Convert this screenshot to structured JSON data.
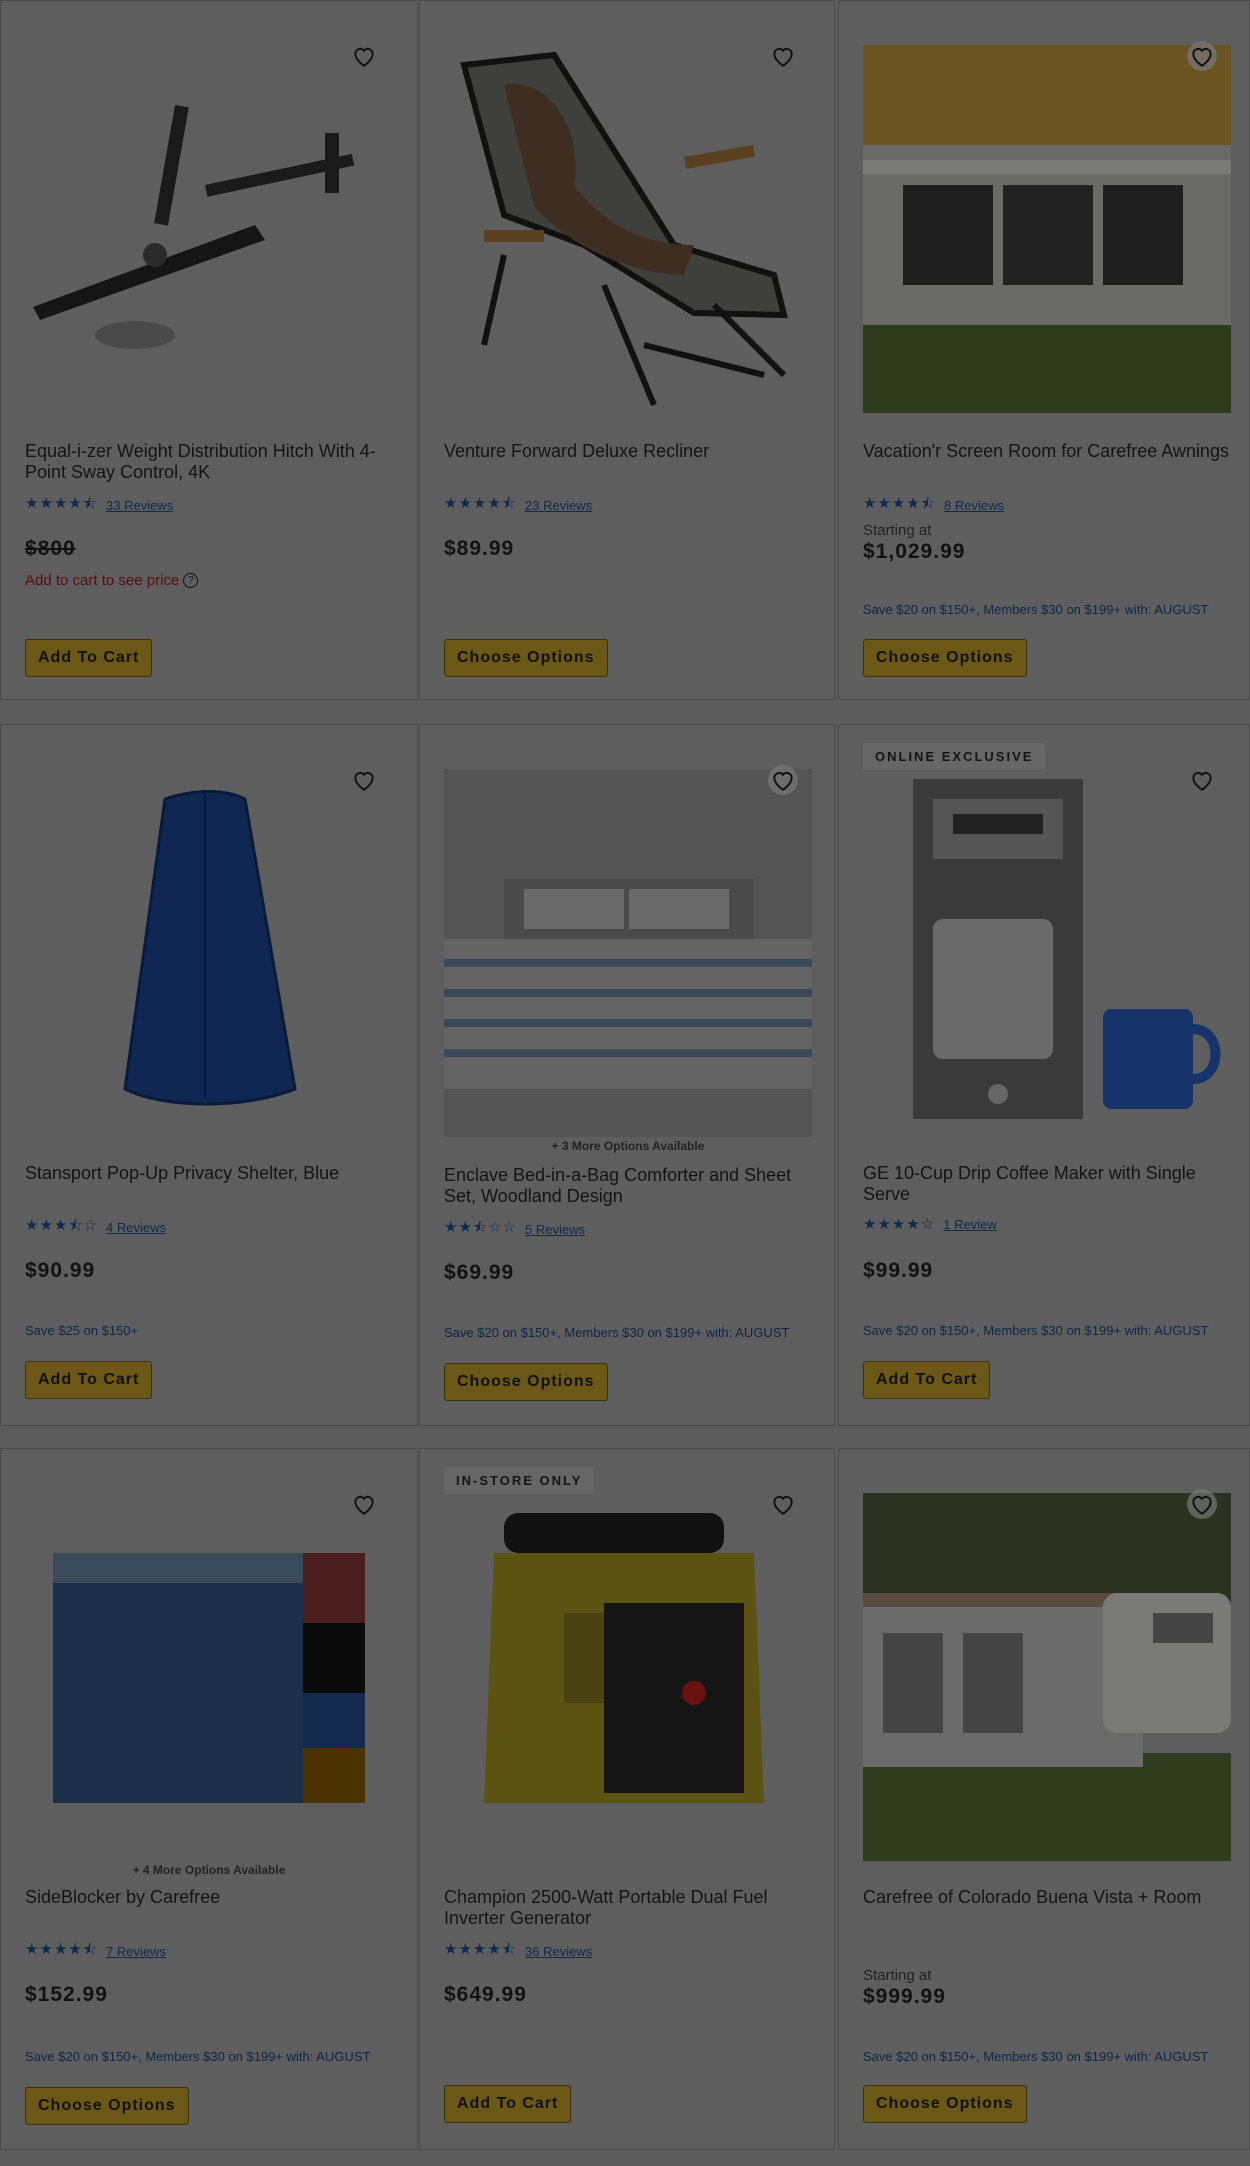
{
  "products": [
    {
      "title": "Equal-i-zer Weight Distribution Hitch With 4-Point Sway Control, 4K",
      "stars": "★★★★⯪",
      "reviews": "33 Reviews",
      "price": "$800",
      "cart_note": "Add to cart to see price",
      "button": "Add To Cart"
    },
    {
      "title": "Venture Forward Deluxe Recliner",
      "stars": "★★★★⯪",
      "reviews": "23 Reviews",
      "price": "$89.99",
      "button": "Choose Options"
    },
    {
      "title": "Vacation'r Screen Room for Carefree Awnings",
      "stars": "★★★★⯪",
      "reviews": "8 Reviews",
      "starting": "Starting at",
      "price": "$1,029.99",
      "promo": "Save $20 on $150+, Members $30 on $199+ with: AUGUST",
      "button": "Choose Options"
    },
    {
      "title": "Stansport Pop-Up Privacy Shelter, Blue",
      "stars": "★★★⯪☆",
      "reviews": "4 Reviews",
      "price": "$90.99",
      "promo": "Save $25 on $150+",
      "button": "Add To Cart"
    },
    {
      "options": "+ 3 More Options Available",
      "title": "Enclave Bed-in-a-Bag Comforter and Sheet Set, Woodland Design",
      "stars": "★★⯪☆☆",
      "reviews": "5 Reviews",
      "price": "$69.99",
      "promo": "Save $20 on $150+, Members $30 on $199+ with: AUGUST",
      "button": "Choose Options"
    },
    {
      "badge": "ONLINE EXCLUSIVE",
      "title": "GE 10-Cup Drip Coffee Maker with Single Serve",
      "stars": "★★★★☆",
      "reviews": "1 Review",
      "price": "$99.99",
      "promo": "Save $20 on $150+, Members $30 on $199+ with: AUGUST",
      "button": "Add To Cart"
    },
    {
      "options": "+ 4 More Options Available",
      "title": "SideBlocker by Carefree",
      "stars": "★★★★⯪",
      "reviews": "7 Reviews",
      "price": "$152.99",
      "promo": "Save $20 on $150+, Members $30 on $199+ with: AUGUST",
      "button": "Choose Options"
    },
    {
      "badge": "IN-STORE ONLY",
      "title": "Champion 2500-Watt Portable Dual Fuel Inverter Generator",
      "stars": "★★★★⯪",
      "reviews": "36 Reviews",
      "price": "$649.99",
      "button": "Add To Cart"
    },
    {
      "title": "Carefree of Colorado Buena Vista + Room",
      "starting": "Starting at",
      "price": "$999.99",
      "promo": "Save $20 on $150+, Members $30 on $199+ with: AUGUST",
      "button": "Choose Options"
    }
  ],
  "colors": {
    "overlay": "#5c5c5c",
    "button": "#6b5817",
    "link": "#0e2a4d",
    "warning": "#5a0d0d"
  }
}
